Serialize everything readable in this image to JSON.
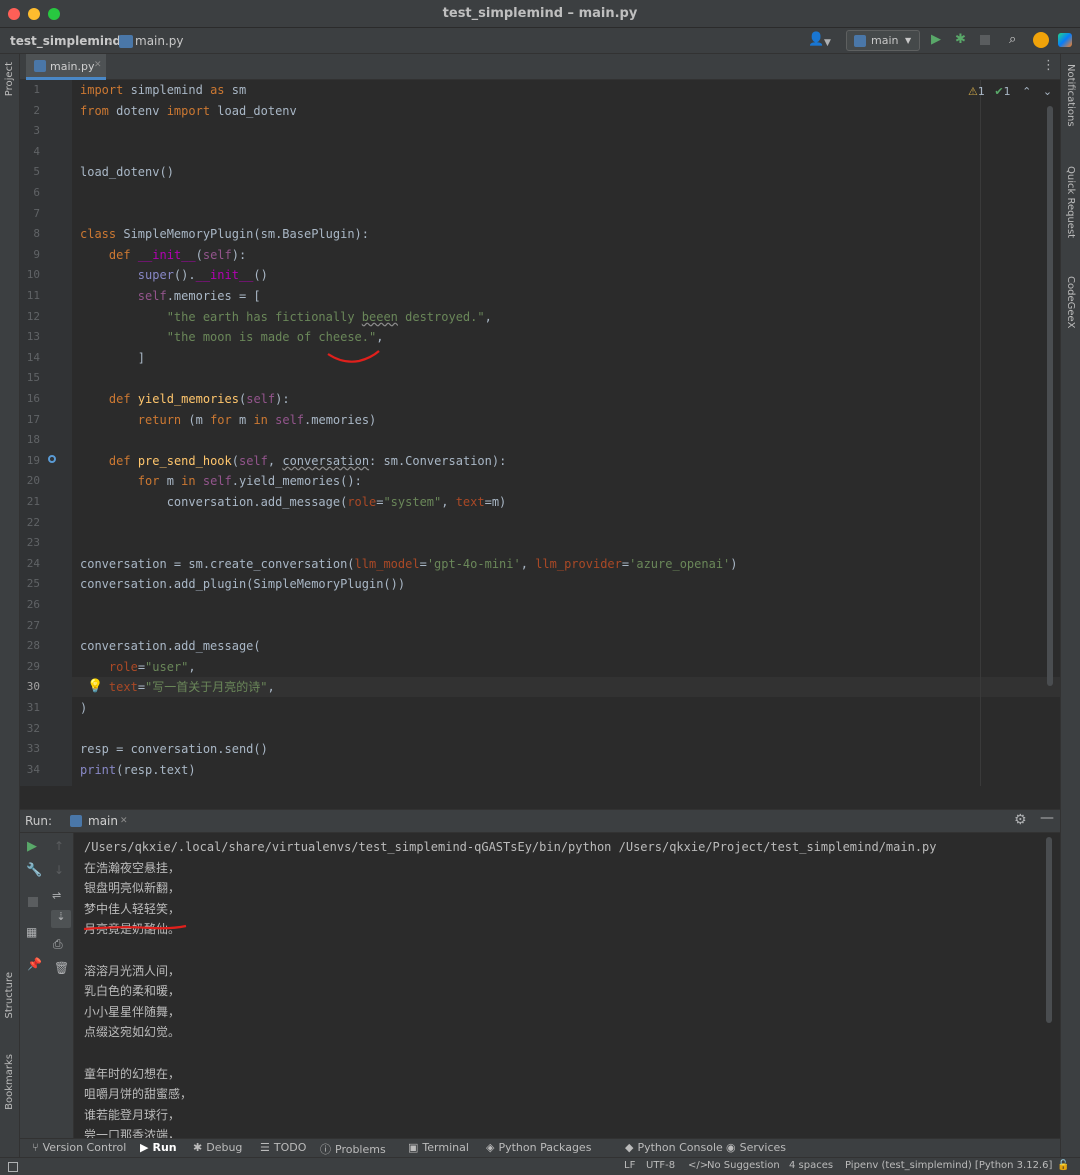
{
  "window": {
    "title": "test_simplemind – main.py"
  },
  "navbar": {
    "project": "test_simplemind",
    "file": "main.py",
    "run_config": "main"
  },
  "editor": {
    "tab_label": "main.py",
    "inspection": {
      "warnings": "1",
      "weak_warnings": "1"
    },
    "lines": [
      {
        "num": "1",
        "html": "<span class=\"kw\">import</span> simplemind <span class=\"kw\">as</span> sm"
      },
      {
        "num": "2",
        "html": "<span class=\"kw\">from</span> dotenv <span class=\"kw\">import</span> load_dotenv"
      },
      {
        "num": "3",
        "html": ""
      },
      {
        "num": "4",
        "html": ""
      },
      {
        "num": "5",
        "html": "load_dotenv()"
      },
      {
        "num": "6",
        "html": ""
      },
      {
        "num": "7",
        "html": ""
      },
      {
        "num": "8",
        "html": "<span class=\"kw\">class</span> SimpleMemoryPlugin(sm.BasePlugin):"
      },
      {
        "num": "9",
        "html": "    <span class=\"kw\">def</span> <span class=\"magic\">__init__</span>(<span class=\"self\">self</span>):"
      },
      {
        "num": "10",
        "html": "        <span class=\"bi\">super</span>().<span class=\"magic\">__init__</span>()"
      },
      {
        "num": "11",
        "html": "        <span class=\"self\">self</span>.memories = ["
      },
      {
        "num": "12",
        "html": "            <span class=\"str\">\"the earth has fictionally <span class=\"wav\">beeen</span> destroyed.\"</span>,"
      },
      {
        "num": "13",
        "html": "            <span class=\"str\">\"the moon is made of cheese.\"</span>,"
      },
      {
        "num": "14",
        "html": "        ]"
      },
      {
        "num": "15",
        "html": ""
      },
      {
        "num": "16",
        "html": "    <span class=\"kw\">def</span> <span class=\"fn\">yield_memories</span>(<span class=\"self\">self</span>):"
      },
      {
        "num": "17",
        "html": "        <span class=\"kw\">return</span> (m <span class=\"kw\">for</span> m <span class=\"kw\">in</span> <span class=\"self\">self</span>.memories)"
      },
      {
        "num": "18",
        "html": ""
      },
      {
        "num": "19",
        "html": "    <span class=\"kw\">def</span> <span class=\"fn\">pre_send_hook</span>(<span class=\"self\">self</span>, <span class=\"wav\">conversation</span>: sm.Conversation):"
      },
      {
        "num": "20",
        "html": "        <span class=\"kw\">for</span> m <span class=\"kw\">in</span> <span class=\"self\">self</span>.yield_memories():"
      },
      {
        "num": "21",
        "html": "            conversation.add_message(<span class=\"param\">role</span>=<span class=\"str\">\"system\"</span>, <span class=\"param\">text</span>=m)"
      },
      {
        "num": "22",
        "html": ""
      },
      {
        "num": "23",
        "html": ""
      },
      {
        "num": "24",
        "html": "conversation = sm.create_conversation(<span class=\"param\">llm_model</span>=<span class=\"str\">'gpt-4o-mini'</span>, <span class=\"param\">llm_provider</span>=<span class=\"str\">'azure_openai'</span>)"
      },
      {
        "num": "25",
        "html": "conversation.add_plugin(SimpleMemoryPlugin())"
      },
      {
        "num": "26",
        "html": ""
      },
      {
        "num": "27",
        "html": ""
      },
      {
        "num": "28",
        "html": "conversation.add_message("
      },
      {
        "num": "29",
        "html": "    <span class=\"param\">role</span>=<span class=\"str\">\"user\"</span>,"
      },
      {
        "num": "30",
        "html": "    <span class=\"param\">text</span>=<span class=\"str\">\"写一首关于月亮的诗\"</span>,"
      },
      {
        "num": "31",
        "html": ")"
      },
      {
        "num": "32",
        "html": ""
      },
      {
        "num": "33",
        "html": "resp = conversation.send()"
      },
      {
        "num": "34",
        "html": "<span class=\"bi\">print</span>(resp.text)"
      }
    ]
  },
  "run_panel": {
    "label": "Run:",
    "tab": "main",
    "console_lines": [
      "/Users/qkxie/.local/share/virtualenvs/test_simplemind-qGASTsEy/bin/python /Users/qkxie/Project/test_simplemind/main.py",
      "在浩瀚夜空悬挂，",
      "银盘明亮似新翻，",
      "梦中佳人轻轻笑，",
      "月亮竟是奶酪仙。",
      "",
      "溶溶月光洒人间，",
      "乳白色的柔和暖，",
      "小小星星伴随舞，",
      "点缀这宛如幻觉。",
      "",
      "童年时的幻想在，",
      "咀嚼月饼的甜蜜感，",
      "谁若能登月球行，",
      "尝一口那香浓端，"
    ]
  },
  "left_strip": {
    "project": "Project",
    "structure": "Structure",
    "bookmarks": "Bookmarks"
  },
  "right_strip": {
    "notifications": "Notifications",
    "quick_request": "Quick Request",
    "codegeex": "CodeGeeX"
  },
  "bottom_tabs": [
    "Version Control",
    "Run",
    "Debug",
    "TODO",
    "Problems",
    "Terminal",
    "Python Packages",
    "Python Console",
    "Services"
  ],
  "status_bar": {
    "line_sep": "LF",
    "encoding": "UTF-8",
    "suggestion": "No Suggestion",
    "indent": "4 spaces",
    "interpreter": "Pipenv (test_simplemind) [Python 3.12.6]"
  },
  "colors": {
    "accent": "#4a88c7",
    "run_green": "#59a869",
    "annotation_red": "#e0201c"
  }
}
